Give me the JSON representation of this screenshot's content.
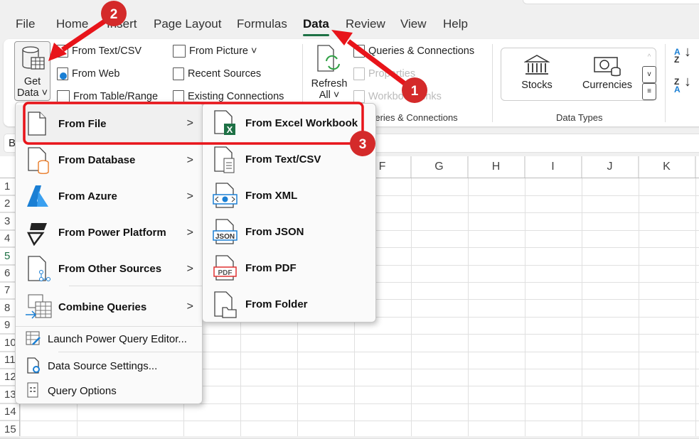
{
  "tabs": [
    "File",
    "Home",
    "Insert",
    "Page Layout",
    "Formulas",
    "Data",
    "Review",
    "View",
    "Help"
  ],
  "active_tab": "Data",
  "ribbon": {
    "get_data": {
      "line1": "Get",
      "line2": "Data ˅"
    },
    "col1": [
      "From Text/CSV",
      "From Web",
      "From Table/Range"
    ],
    "col2": [
      "From Picture ˅",
      "Recent Sources",
      "Existing Connections"
    ],
    "refresh": {
      "line1": "Refresh",
      "line2": "All ˅"
    },
    "queries": [
      "Queries & Connections",
      "Properties",
      "Workbook Links"
    ],
    "queries_group": "Queries & Connections",
    "data_types": {
      "items": [
        "Stocks",
        "Currencies"
      ],
      "group": "Data Types"
    },
    "sort": [
      "A→Z",
      "Z→A"
    ]
  },
  "name_box": "B",
  "columns": [
    "F",
    "G",
    "H",
    "I",
    "J",
    "K"
  ],
  "rows": [
    "1",
    "2",
    "3",
    "4",
    "5",
    "6",
    "7",
    "8",
    "9",
    "10",
    "11",
    "12",
    "13",
    "14",
    "15"
  ],
  "menu": {
    "items": [
      {
        "label": "From File",
        "icon": "file-icon",
        "submenu": true
      },
      {
        "label": "From Database",
        "icon": "database-icon",
        "submenu": true
      },
      {
        "label": "From Azure",
        "icon": "azure-icon",
        "submenu": true
      },
      {
        "label": "From Power Platform",
        "icon": "power-platform-icon",
        "submenu": true
      },
      {
        "label": "From Other Sources",
        "icon": "other-sources-icon",
        "submenu": true
      },
      {
        "label": "Combine Queries",
        "icon": "combine-icon",
        "submenu": true
      }
    ],
    "actions": [
      "Launch Power Query Editor...",
      "Data Source Settings...",
      "Query Options"
    ]
  },
  "submenu": {
    "items": [
      "From Excel Workbook",
      "From Text/CSV",
      "From XML",
      "From JSON",
      "From PDF",
      "From Folder"
    ],
    "icon_text": {
      "excel": "X",
      "xml": "<⊕>",
      "json": "JSON",
      "pdf": "PDF"
    }
  },
  "annotations": {
    "badges": [
      "1",
      "2",
      "3"
    ],
    "color": "#e8141a"
  },
  "colors": {
    "accent": "#1e7145",
    "excel": "#1e7145",
    "azure": "#1a7fd4",
    "database": "#e8731a"
  }
}
